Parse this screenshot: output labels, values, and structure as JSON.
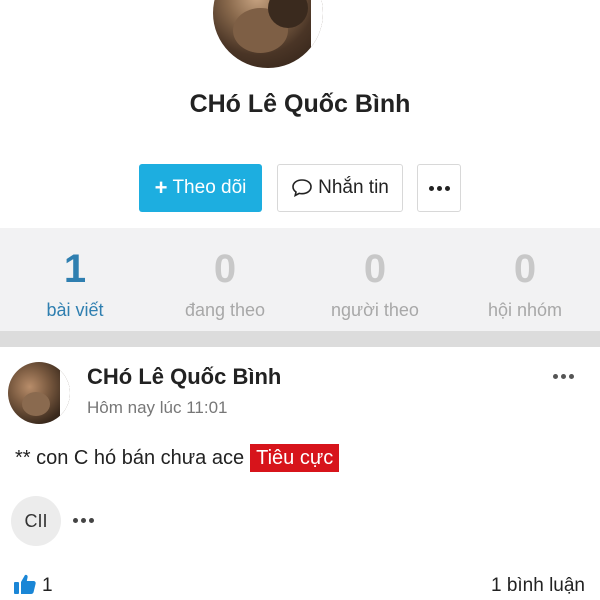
{
  "profile": {
    "name": "CHó Lê Quốc Bình",
    "follow_label": "Theo dõi",
    "message_label": "Nhắn tin"
  },
  "stats": [
    {
      "value": "1",
      "label": "bài viết"
    },
    {
      "value": "0",
      "label": "đang theo"
    },
    {
      "value": "0",
      "label": "người theo"
    },
    {
      "value": "0",
      "label": "hội nhóm"
    }
  ],
  "post": {
    "author": "CHó Lê Quốc Bình",
    "time": "Hôm nay lúc 11:01",
    "content": "** con C hó bán chưa ace",
    "tag": "Tiêu cực",
    "chip_label": "CII",
    "like_count": "1",
    "comment_count": "1 bình luận"
  },
  "colors": {
    "accent": "#1daee0",
    "active_stat": "#2f7fb0",
    "negative_tag": "#d7141b",
    "like_blue": "#1a86d6"
  },
  "icons": [
    "plus-icon",
    "chat-bubble-icon",
    "more-dots-icon",
    "thumbs-up-icon"
  ]
}
